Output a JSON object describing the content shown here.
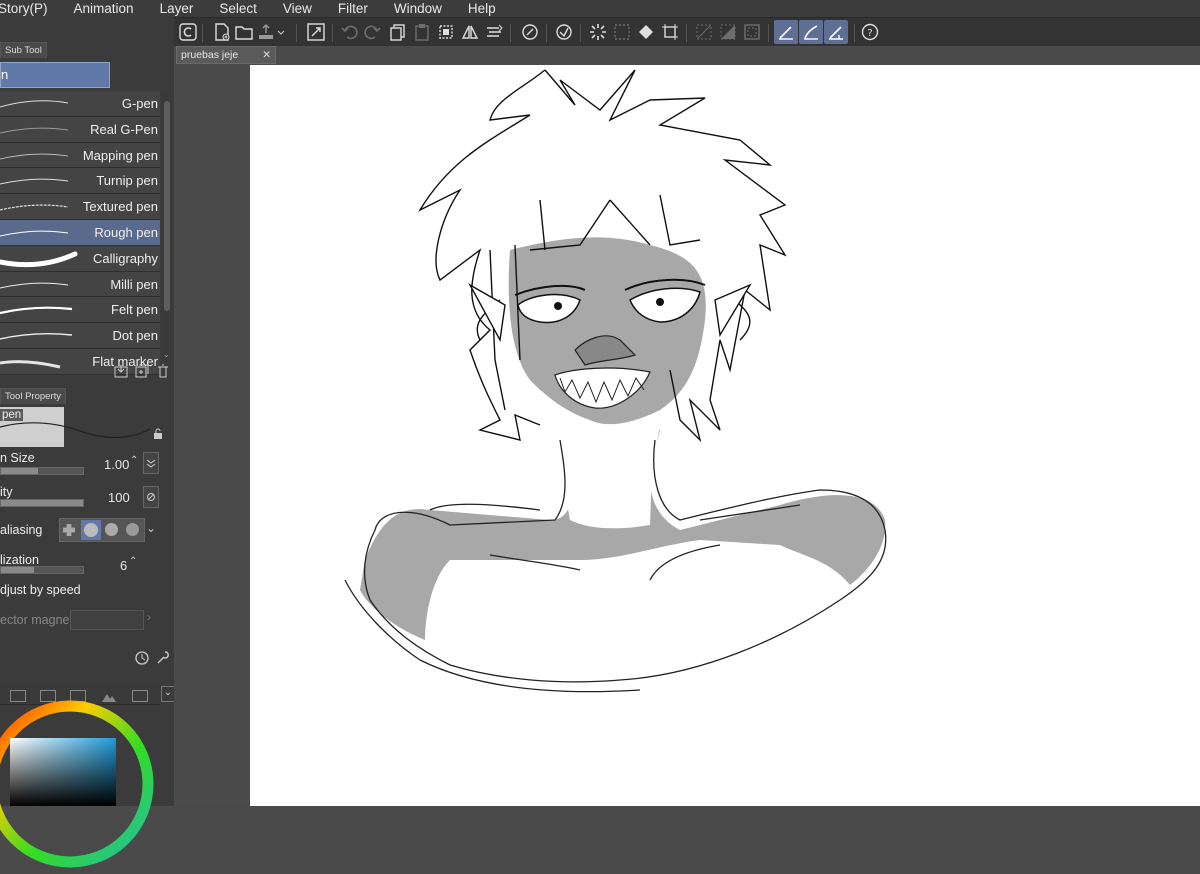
{
  "menu": [
    "Story(P)",
    "Animation",
    "Layer",
    "Select",
    "View",
    "Filter",
    "Window",
    "Help"
  ],
  "panels": {
    "subtool_tab": "Sub Tool",
    "group_label": "n",
    "tool_property_tab": "Tool Property"
  },
  "brushes": [
    {
      "label": "G-pen",
      "selected": false
    },
    {
      "label": "Real G-Pen",
      "selected": false
    },
    {
      "label": "Mapping pen",
      "selected": false
    },
    {
      "label": "Turnip pen",
      "selected": false
    },
    {
      "label": "Textured pen",
      "selected": false
    },
    {
      "label": "Rough pen",
      "selected": true
    },
    {
      "label": "Calligraphy",
      "selected": false
    },
    {
      "label": "Milli pen",
      "selected": false
    },
    {
      "label": "Felt pen",
      "selected": false
    },
    {
      "label": "Dot pen",
      "selected": false
    },
    {
      "label": "Flat marker",
      "selected": false
    }
  ],
  "tool_property": {
    "preview_label": "pen",
    "brush_size_label": "n Size",
    "brush_size_value": "1.00",
    "opacity_label": "ity",
    "opacity_value": "100",
    "antialiasing_label": "aliasing",
    "stabilization_label": "lization",
    "stabilization_value": "6",
    "adjust_label": "djust by speed",
    "vector_magnet_label": "ector magnet"
  },
  "document": {
    "tab_title": "pruebas jeje",
    "close_glyph": "✕"
  },
  "colors": {
    "accent": "#6179a8",
    "selected_row": "#5a6a8d",
    "skin_shade": "#a8a8a8"
  }
}
